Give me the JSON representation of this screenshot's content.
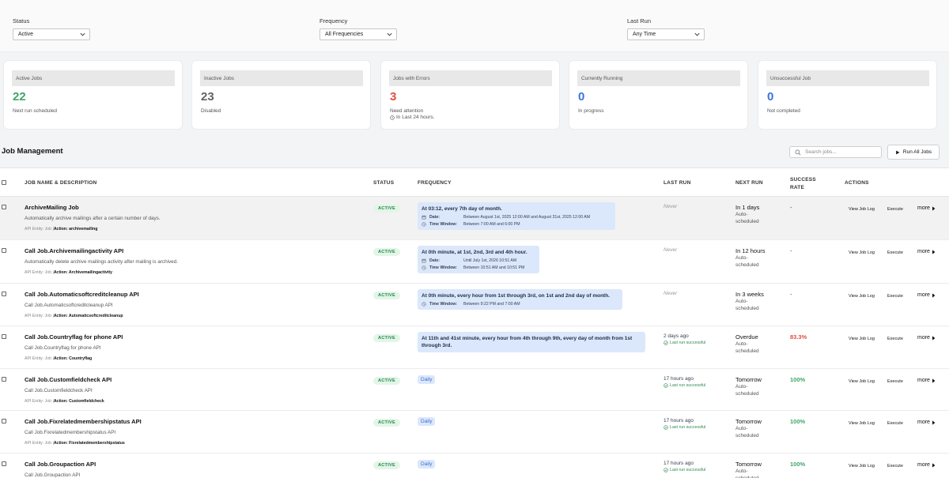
{
  "filters": [
    {
      "label": "Status",
      "value": "Active"
    },
    {
      "label": "Frequency",
      "value": "All Frequencies"
    },
    {
      "label": "Last Run",
      "value": "Any Time"
    }
  ],
  "stats": [
    {
      "title": "Active Jobs",
      "value": "22",
      "sub": "Next run scheduled",
      "sub2": "",
      "color": "#3fa66a"
    },
    {
      "title": "Inactive Jobs",
      "value": "23",
      "sub": "Disabled",
      "sub2": "",
      "color": "#5f6368"
    },
    {
      "title": "Jobs with Errors",
      "value": "3",
      "sub": "Need attention",
      "sub2": "In Last 24 hours.",
      "color": "#e24c3f"
    },
    {
      "title": "Currently Running",
      "value": "0",
      "sub": "In progress",
      "sub2": "",
      "color": "#3b73d9"
    },
    {
      "title": "Unsuccessful Job",
      "value": "0",
      "sub": "Not completed",
      "sub2": "",
      "color": "#3b73d9"
    }
  ],
  "management": {
    "title": "Job Management",
    "search_placeholder": "Search jobs...",
    "run_all_label": "Run All Jobs"
  },
  "columns": {
    "name": "JOB NAME & DESCRIPTION",
    "status": "STATUS",
    "frequency": "FREQUENCY",
    "last_run": "LAST RUN",
    "next_run": "NEXT RUN",
    "success_1": "SUCCESS",
    "success_2": "RATE",
    "actions": "ACTIONS"
  },
  "labels": {
    "entity_prefix": "API Entity: Job |",
    "view_log": "View Job Log",
    "execute": "Execute",
    "more": "more",
    "date": "Date:",
    "time_window": "Time Window:",
    "auto_scheduled": "Auto-scheduled",
    "last_success": "Last run successful"
  },
  "rows": [
    {
      "name": "ArchiveMailing Job",
      "desc": "Automatically archive mailings after a certain number of days.",
      "action": "Action: archivemailing",
      "status": "ACTIVE",
      "freq_main": "At 03:12, every 7th day of month.",
      "freq_date": "Between August 1st, 2025 12:00 AM and August 31st, 2025 12:00 AM",
      "freq_time": "Between 7:00 AM and 6:00 PM",
      "last_run": "Never",
      "last_sub": "",
      "next_run": "In 1 days",
      "rate": "-"
    },
    {
      "name": "Call Job.Archivemailingactivity API",
      "desc": "Automatically delete archive mailings activity after mailing is archived.",
      "action": "Action: Archivemailingactivity",
      "status": "ACTIVE",
      "freq_main": "At 0th minute, at 1st, 2nd, 3rd and 4th hour.",
      "freq_date": "Until July 1st, 2026 10:51 AM",
      "freq_time": "Between 10:51 AM and 10:51 PM",
      "last_run": "Never",
      "last_sub": "",
      "next_run": "In 12 hours",
      "rate": "-"
    },
    {
      "name": "Call Job.Automaticsoftcreditcleanup API",
      "desc": "Call Job.Automaticsoftcreditcleanup API",
      "action": "Action: Automaticsoftcreditcleanup",
      "status": "ACTIVE",
      "freq_main": "At 0th minute, every hour from 1st through 3rd, on 1st and 2nd day of month.",
      "freq_date": "",
      "freq_time": "Between 9:22 PM and 7:00 AM",
      "last_run": "Never",
      "last_sub": "",
      "next_run": "In 3 weeks",
      "rate": "-"
    },
    {
      "name": "Call Job.Countryflag for phone API",
      "desc": "Call Job.Countryflag for phone API",
      "action": "Action: Countryflag",
      "status": "ACTIVE",
      "freq_main": "At 11th and 41st minute, every hour from 4th through 9th, every day of month from 1st through 3rd.",
      "freq_date": "",
      "freq_time": "",
      "last_run": "2 days ago",
      "last_sub": "Last run successful",
      "next_run": "Overdue",
      "rate": "83.3%"
    },
    {
      "name": "Call Job.Customfieldcheck API",
      "desc": "Call Job.Customfieldcheck API",
      "action": "Action: Customfieldcheck",
      "status": "ACTIVE",
      "freq_main": "Daily",
      "freq_date": "",
      "freq_time": "",
      "last_run": "17 hours ago",
      "last_sub": "Last run successful",
      "next_run": "Tomorrow",
      "rate": "100%"
    },
    {
      "name": "Call Job.Fixrelatedmembershipstatus API",
      "desc": "Call Job.Fixrelatedmembershipstatus API",
      "action": "Action: Fixrelatedmembershipstatus",
      "status": "ACTIVE",
      "freq_main": "Daily",
      "freq_date": "",
      "freq_time": "",
      "last_run": "17 hours ago",
      "last_sub": "Last run successful",
      "next_run": "Tomorrow",
      "rate": "100%"
    },
    {
      "name": "Call Job.Groupaction API",
      "desc": "Call Job.Groupaction API",
      "action": "",
      "status": "ACTIVE",
      "freq_main": "Daily",
      "freq_date": "",
      "freq_time": "",
      "last_run": "17 hours ago",
      "last_sub": "Last run successful",
      "next_run": "Tomorrow",
      "rate": "100%"
    }
  ],
  "colors": {
    "success": "#3fa66a",
    "warning": "#e24c3f",
    "accent": "#3b73d9"
  },
  "icons": {
    "chevron": "chevron-down-icon",
    "search": "search-icon",
    "play": "play-icon",
    "calendar": "calendar-icon",
    "clock": "clock-icon",
    "check": "check-circle-icon",
    "caret": "caret-right-icon"
  }
}
